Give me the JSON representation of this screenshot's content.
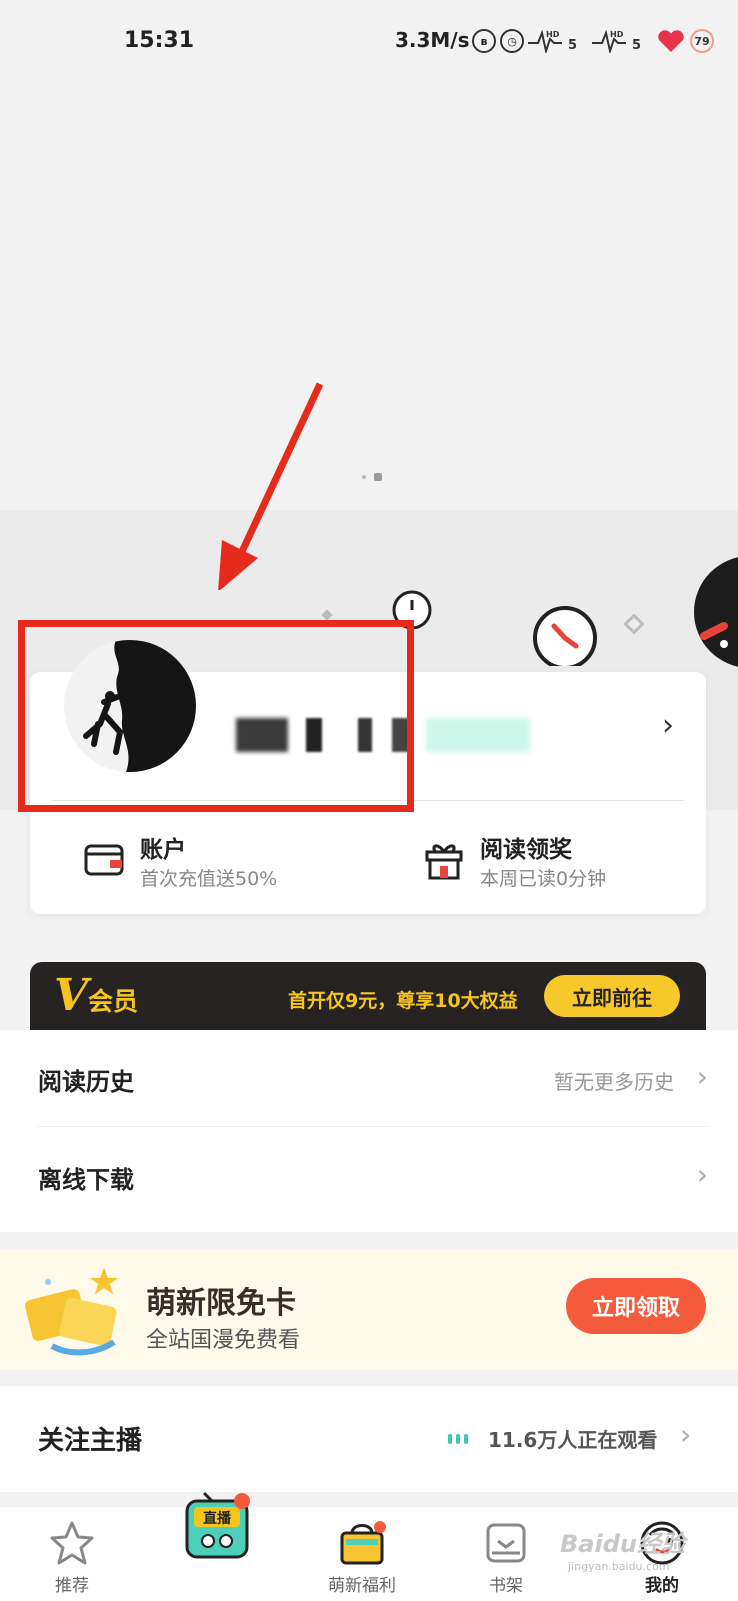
{
  "status_bar": {
    "time": "15:31",
    "network_speed": "3.3M/s",
    "signal_1": "5",
    "signal_2": "5",
    "hd_1": "HD",
    "hd_2": "HD",
    "battery": "79"
  },
  "profile": {
    "username_blurred": true
  },
  "account_row": [
    {
      "title": "账户",
      "subtitle": "首次充值送50%",
      "icon": "wallet-icon"
    },
    {
      "title": "阅读领奖",
      "subtitle": "本周已读0分钟",
      "icon": "gift-icon"
    }
  ],
  "vip": {
    "v_letter": "V",
    "label": "会员",
    "promo": "首开仅9元，尊享10大权益",
    "button": "立即前往"
  },
  "menu": [
    {
      "label": "阅读历史",
      "hint": "暂无更多历史"
    },
    {
      "label": "离线下载",
      "hint": ""
    }
  ],
  "free_card": {
    "title": "萌新限免卡",
    "subtitle": "全站国漫免费看",
    "button": "立即领取"
  },
  "follow": {
    "title": "关注主播",
    "count": "11.6万人正在观看"
  },
  "bottom_nav": [
    {
      "label": "推荐",
      "icon": "star-icon",
      "active": false
    },
    {
      "label": "直播",
      "icon": "live-tv-icon",
      "active": false
    },
    {
      "label": "萌新福利",
      "icon": "gift-basket-icon",
      "active": false
    },
    {
      "label": "书架",
      "icon": "bookshelf-icon",
      "active": false
    },
    {
      "label": "我的",
      "icon": "profile-face-icon",
      "active": true
    }
  ],
  "watermark": {
    "text": "Baidu经验",
    "sub": "jingyan.baidu.com"
  },
  "colors": {
    "highlight": "#e62a1c",
    "vip_gold": "#f5c51e",
    "cta_orange": "#f45a3c",
    "live_teal": "#3bc8b3"
  }
}
